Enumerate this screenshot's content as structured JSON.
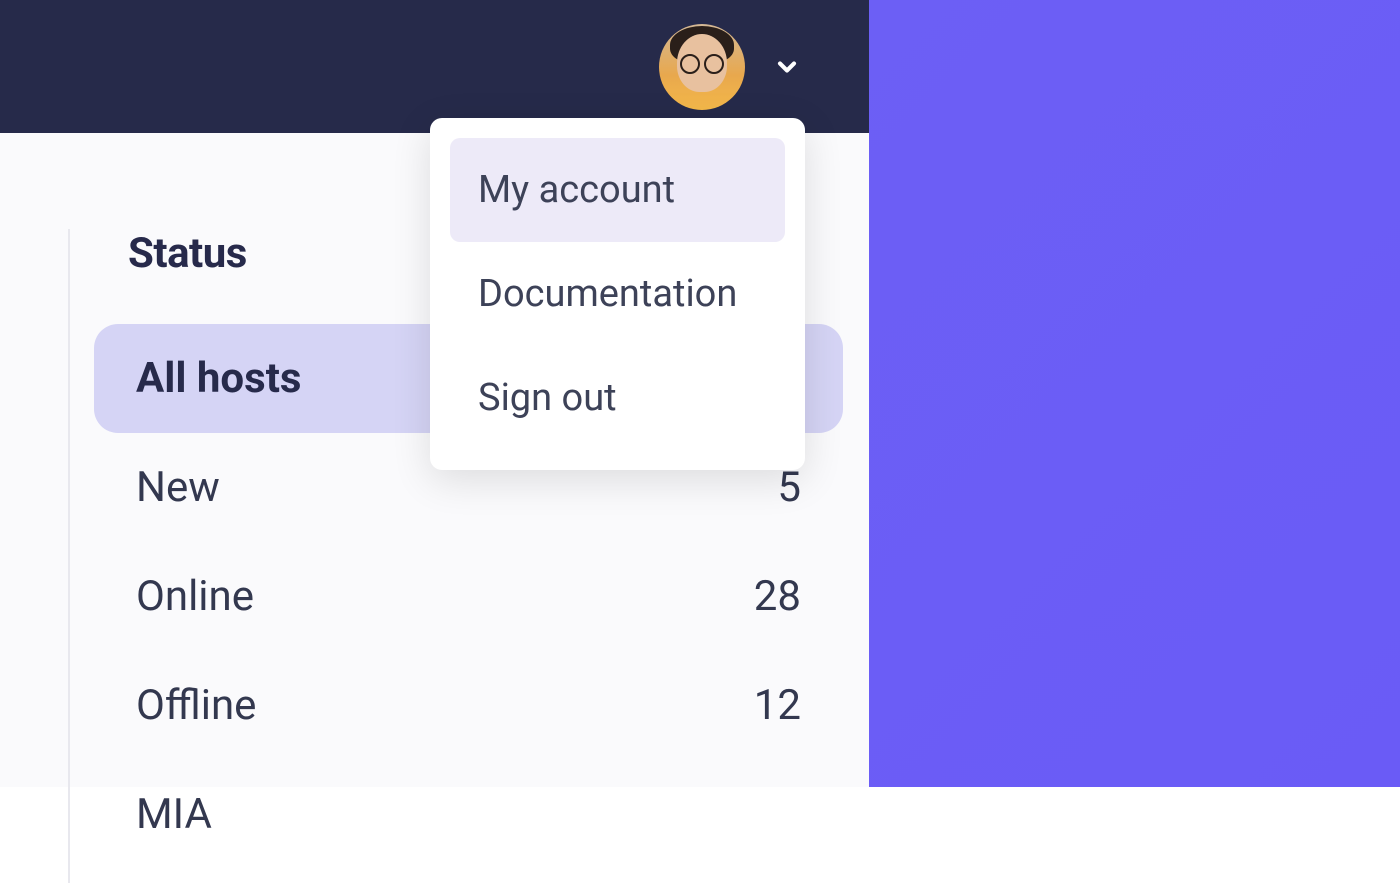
{
  "header": {
    "dropdown": {
      "items": [
        {
          "label": "My account",
          "highlighted": true
        },
        {
          "label": "Documentation",
          "highlighted": false
        },
        {
          "label": "Sign out",
          "highlighted": false
        }
      ]
    }
  },
  "sidebar": {
    "heading": "Status",
    "items": [
      {
        "label": "All hosts",
        "count": "",
        "active": true
      },
      {
        "label": "New",
        "count": "5",
        "active": false
      },
      {
        "label": "Online",
        "count": "28",
        "active": false
      },
      {
        "label": "Offline",
        "count": "12",
        "active": false
      },
      {
        "label": "MIA",
        "count": "",
        "active": false
      }
    ]
  }
}
